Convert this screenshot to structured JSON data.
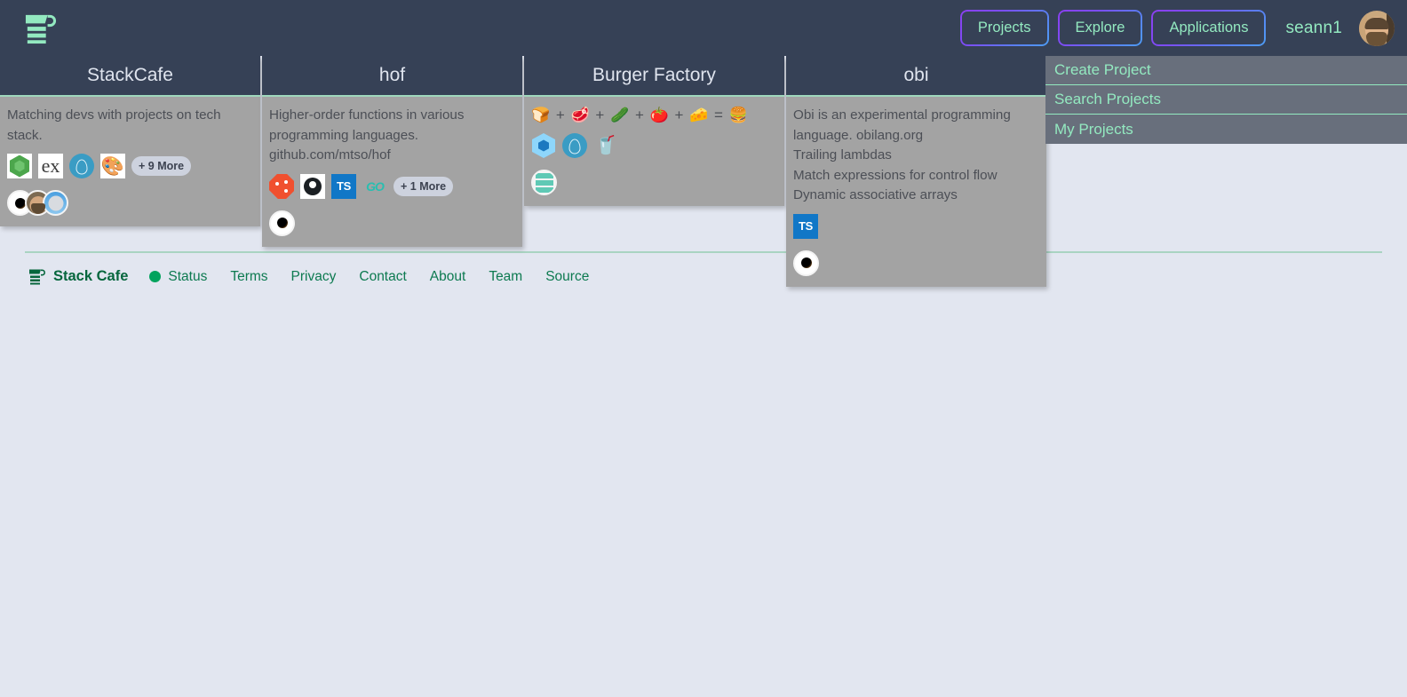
{
  "navbar": {
    "logo_icon": "stack-cafe-cup-logo",
    "buttons": [
      {
        "label": "Projects",
        "name": "projects"
      },
      {
        "label": "Explore",
        "name": "explore"
      },
      {
        "label": "Applications",
        "name": "applications"
      }
    ],
    "username": "seann1",
    "accent_green": "#93e9c0",
    "background": "#364156"
  },
  "dropdown": {
    "open": true,
    "background": "#686f7c",
    "items": [
      {
        "label": "Create Project"
      },
      {
        "label": "Search Projects"
      },
      {
        "label": "My Projects"
      }
    ]
  },
  "cards": [
    {
      "title": "StackCafe",
      "description": "Matching devs with projects on tech stack.",
      "emoji_line": "",
      "tech": [
        {
          "icon": "nodejs-icon",
          "label": "Node.js"
        },
        {
          "icon": "express-icon",
          "label": "Express"
        },
        {
          "icon": "elixir-icon",
          "label": "Elixir"
        },
        {
          "icon": "sinatra-icon",
          "label": "Sinatra"
        }
      ],
      "more_label": "+ 9 More",
      "members": [
        "member-dot",
        "member-beard",
        "member-koala"
      ]
    },
    {
      "title": "hof",
      "description": "Higher-order functions in various\nprogramming languages.\ngithub.com/mtso/hof",
      "emoji_line": "",
      "tech": [
        {
          "icon": "git-icon",
          "label": "Git"
        },
        {
          "icon": "github-icon",
          "label": "GitHub"
        },
        {
          "icon": "typescript-icon",
          "label": "TypeScript"
        },
        {
          "icon": "go-icon",
          "label": "Go"
        }
      ],
      "more_label": "+ 1 More",
      "members": [
        "member-dot"
      ]
    },
    {
      "title": "Burger Factory",
      "description": "",
      "emoji_line": "🍞 + 🥩 + 🥒 + 🍅 + 🧀 = 🍔",
      "tech": [
        {
          "icon": "webpack-icon",
          "label": "Webpack"
        },
        {
          "icon": "elixir-icon",
          "label": "Elixir"
        },
        {
          "icon": "soda-cup-icon",
          "label": "Soda"
        }
      ],
      "more_label": "",
      "members": [
        "member-teal"
      ]
    },
    {
      "title": "obi",
      "description": "Obi is an experimental programming\nlanguage. obilang.org\nTrailing lambdas\nMatch expressions for control flow\nDynamic associative arrays",
      "emoji_line": "",
      "tech": [
        {
          "icon": "typescript-icon",
          "label": "TypeScript"
        }
      ],
      "more_label": "",
      "members": [
        "member-dot"
      ]
    }
  ],
  "footer": {
    "brand": "Stack Cafe",
    "brand_icon": "stack-cafe-cup-logo",
    "status_label": "Status",
    "status_color": "#02a35d",
    "links": [
      {
        "label": "Terms"
      },
      {
        "label": "Privacy"
      },
      {
        "label": "Contact"
      },
      {
        "label": "About"
      },
      {
        "label": "Team"
      },
      {
        "label": "Source"
      }
    ]
  }
}
